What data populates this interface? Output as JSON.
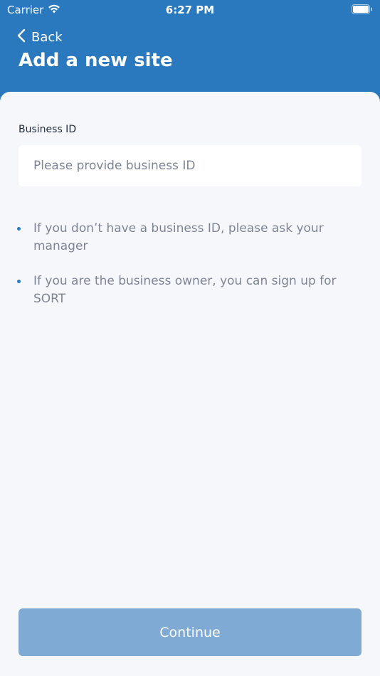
{
  "status_bar": {
    "carrier": "Carrier",
    "time": "6:27 PM",
    "wifi_icon": "wifi-icon",
    "battery_icon": "battery-icon"
  },
  "header": {
    "back_label": "Back",
    "back_icon": "chevron-left-icon",
    "title": "Add a new site"
  },
  "form": {
    "business_id_label": "Business ID",
    "business_id_value": "",
    "business_id_placeholder": "Please provide business ID"
  },
  "tips": [
    "If you don’t have a business ID, please ask your manager",
    "If you are the business owner, you can sign up for SORT"
  ],
  "actions": {
    "continue_label": "Continue",
    "continue_enabled": false
  },
  "colors": {
    "header_bg": "#2a78bd",
    "sheet_bg": "#f6f7fb",
    "button_disabled": "#7eaad4",
    "muted_text": "#7d8596",
    "bullet": "#2a78bd"
  }
}
